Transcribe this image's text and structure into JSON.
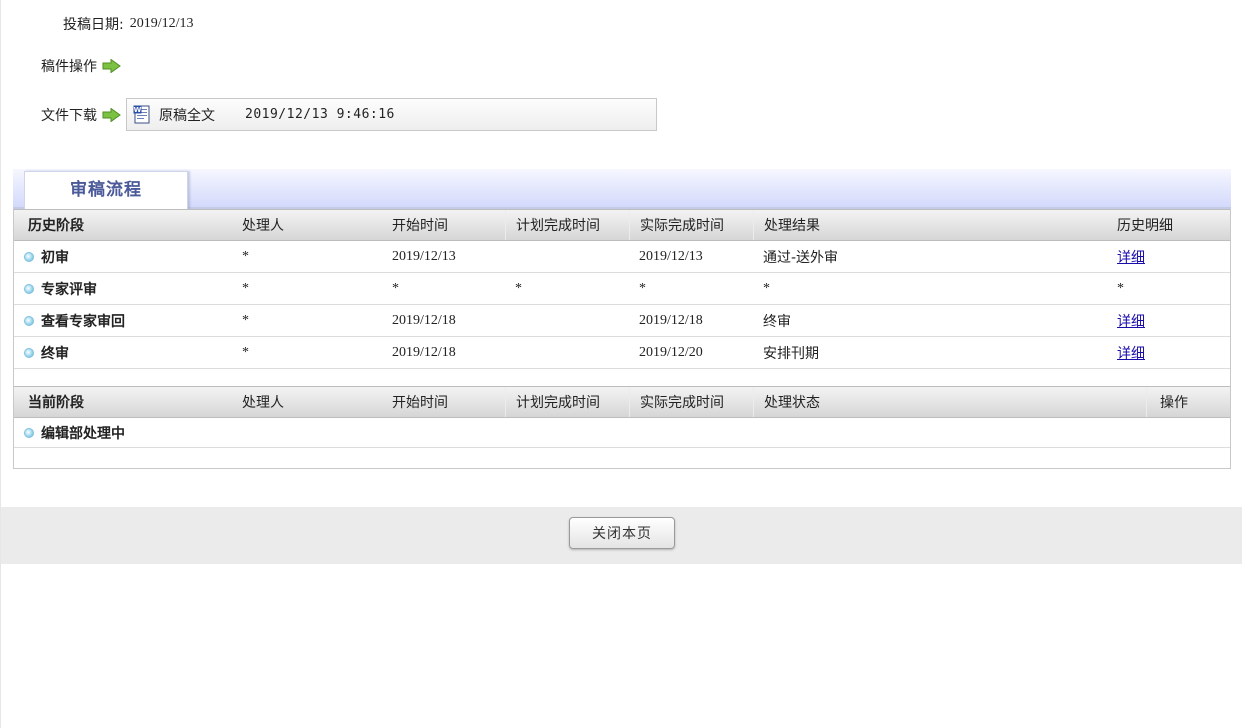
{
  "submission": {
    "date_label": "投稿日期:",
    "date_value": "2019/12/13"
  },
  "manuscript_ops": {
    "label": "稿件操作"
  },
  "download": {
    "label": "文件下载",
    "file_name": "原稿全文",
    "file_time": "2019/12/13 9:46:16"
  },
  "tab": {
    "label": "审稿流程"
  },
  "history": {
    "headers": {
      "stage": "历史阶段",
      "handler": "处理人",
      "start": "开始时间",
      "planned": "计划完成时间",
      "actual": "实际完成时间",
      "result": "处理结果",
      "detail": "历史明细"
    },
    "rows": [
      {
        "stage": "初审",
        "handler": "*",
        "start": "2019/12/13",
        "planned": "",
        "actual": "2019/12/13",
        "result": "通过-送外审",
        "detail": "详细"
      },
      {
        "stage": "专家评审",
        "handler": "*",
        "start": "*",
        "planned": "*",
        "actual": "*",
        "result": "*",
        "detail": "*"
      },
      {
        "stage": "查看专家审回",
        "handler": "*",
        "start": "2019/12/18",
        "planned": "",
        "actual": "2019/12/18",
        "result": "终审",
        "detail": "详细"
      },
      {
        "stage": "终审",
        "handler": "*",
        "start": "2019/12/18",
        "planned": "",
        "actual": "2019/12/20",
        "result": "安排刊期",
        "detail": "详细"
      }
    ]
  },
  "current": {
    "headers": {
      "stage": "当前阶段",
      "handler": "处理人",
      "start": "开始时间",
      "planned": "计划完成时间",
      "actual": "实际完成时间",
      "status": "处理状态",
      "op": "操作"
    },
    "rows": [
      {
        "stage": "编辑部处理中"
      }
    ]
  },
  "footer": {
    "close_label": "关闭本页"
  },
  "colors": {
    "tab_text": "#4a5a9a",
    "link": "#1a0dab",
    "arrow": "#7cc242"
  }
}
